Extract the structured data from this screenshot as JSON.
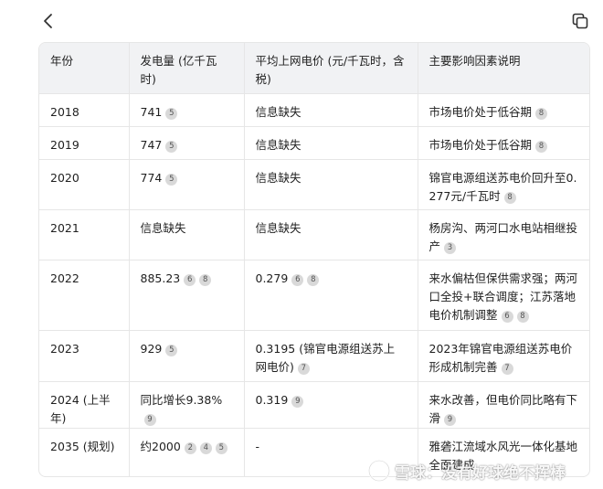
{
  "toolbar": {
    "back_icon": "chevron-left-icon",
    "copy_icon": "copy-icon"
  },
  "table": {
    "headers": [
      "年份",
      "发电量 (亿千瓦时)",
      "平均上网电价 (元/千瓦时，含税)",
      "主要影响因素说明"
    ],
    "rows": [
      {
        "year": "2018",
        "generation": "741",
        "generation_cites": [
          "5"
        ],
        "price": "信息缺失",
        "price_cites": [],
        "factors": "市场电价处于低谷期",
        "factors_cites": [
          "8"
        ]
      },
      {
        "year": "2019",
        "generation": "747",
        "generation_cites": [
          "5"
        ],
        "price": "信息缺失",
        "price_cites": [],
        "factors": "市场电价处于低谷期",
        "factors_cites": [
          "8"
        ]
      },
      {
        "year": "2020",
        "generation": "774",
        "generation_cites": [
          "5"
        ],
        "price": "信息缺失",
        "price_cites": [],
        "factors": "锦官电源组送苏电价回升至0.277元/千瓦时",
        "factors_cites": [
          "8"
        ]
      },
      {
        "year": "2021",
        "generation": "信息缺失",
        "generation_cites": [],
        "price": "信息缺失",
        "price_cites": [],
        "factors": "杨房沟、两河口水电站相继投产",
        "factors_cites": [
          "3"
        ]
      },
      {
        "year": "2022",
        "generation": "885.23",
        "generation_cites": [
          "6",
          "8"
        ],
        "price": "0.279",
        "price_cites": [
          "6",
          "8"
        ],
        "factors": "来水偏枯但保供需求强；两河口全投+联合调度；江苏落地电价机制调整",
        "factors_cites": [
          "6",
          "8"
        ]
      },
      {
        "year": "2023",
        "generation": "929",
        "generation_cites": [
          "5"
        ],
        "price": "0.3195 (锦官电源组送苏上网电价)",
        "price_cites": [
          "7"
        ],
        "factors": "2023年锦官电源组送苏电价形成机制完善",
        "factors_cites": [
          "7"
        ]
      },
      {
        "year": "2024 (上半年)",
        "generation": "同比增长9.38%",
        "generation_cites": [
          "9"
        ],
        "price": "0.319",
        "price_cites": [
          "9"
        ],
        "factors": "来水改善，但电价同比略有下滑",
        "factors_cites": [
          "9"
        ]
      },
      {
        "year": "2035 (规划)",
        "generation": "约2000",
        "generation_cites": [
          "2",
          "4",
          "5"
        ],
        "price": "-",
        "price_cites": [],
        "factors": "雅砻江流域水风光一体化基地全面建成",
        "factors_cites": []
      }
    ]
  },
  "watermark": {
    "text": "雪球：没有好球绝不挥棒",
    "logo_icon": "snowball-logo-icon"
  }
}
